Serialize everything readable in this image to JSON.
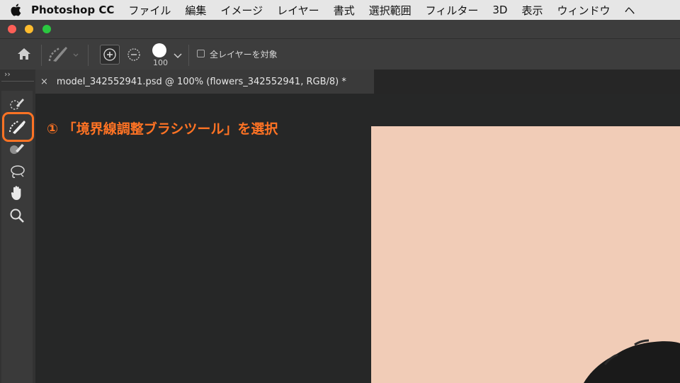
{
  "menubar": {
    "app_name": "Photoshop CC",
    "items": [
      "ファイル",
      "編集",
      "イメージ",
      "レイヤー",
      "書式",
      "選択範囲",
      "フィルター",
      "3D",
      "表示",
      "ウィンドウ",
      "ヘ"
    ]
  },
  "options": {
    "brush_size": "100",
    "sample_all_layers_label": "全レイヤーを対象"
  },
  "document": {
    "tab_label": "model_342552941.psd @ 100% (flowers_342552941, RGB/8) *",
    "close_glyph": "×"
  },
  "collapse_glyph": "››",
  "annotation": {
    "text": "① 「境界線調整ブラシツール」を選択"
  },
  "colors": {
    "accent": "#ff7324",
    "canvas_bg": "#f1ccb7",
    "toolbar_bg": "#3d3d3d"
  },
  "tools": [
    "quick-selection-icon",
    "refine-edge-brush-icon",
    "brush-icon",
    "lasso-icon",
    "hand-icon",
    "zoom-icon"
  ]
}
